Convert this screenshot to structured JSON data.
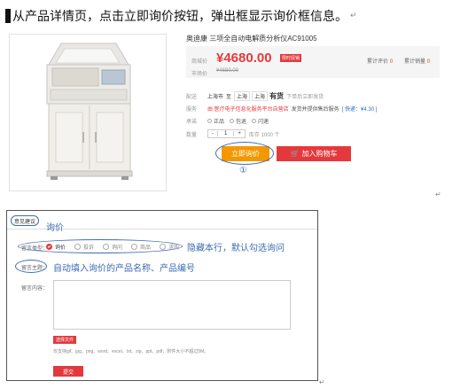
{
  "intro": {
    "text": "从产品详情页，点击立即询价按钮，弹出框显示询价框信息。",
    "para_mark": "↵"
  },
  "product": {
    "title": "奥迪康 三项全自动电解质分析仪AC91005",
    "price_label": "商城价",
    "price": "¥4680.00",
    "discount_tag": "限时促销",
    "market_label": "市场价",
    "market_price": "¥4680.00",
    "review_label": "累计评价",
    "review_count": "0",
    "sales_label": "累计销量",
    "sales_count": "0",
    "ship_label": "配送",
    "ship_from": "上海市",
    "ship_to_word": "至",
    "ship_province": "上海",
    "ship_city": "上海",
    "in_stock": "有货",
    "order_hint": "下单后立即发货",
    "service_label": "服务",
    "service_provider": "由 医疗电子信息化服务平台自营店",
    "service_text": "发货并提供售后服务",
    "service_fee": "[ 快递：¥4.30 ]",
    "pay_label": "承诺",
    "pay_options": [
      "正品",
      "包退",
      "闪速"
    ],
    "qty_label": "数量",
    "qty_minus": "-",
    "qty_value": "1",
    "qty_plus": "+",
    "stock_text": "库存 1000 个",
    "inquiry_button": "立即询价",
    "cart_icon": "cart-icon",
    "cart_button": "加入购物车",
    "annotation_number": "①",
    "para_mark": "↵"
  },
  "form": {
    "tab_label": "意见建议",
    "tab_note": "询价",
    "type_label": "留言类型：",
    "type_options": [
      "询价",
      "投诉",
      "询问",
      "商品",
      "求购"
    ],
    "type_selected": "询价",
    "type_note": "隐藏本行，默认勾选询问",
    "subject_label": "留言主题：",
    "subject_note": "自动填入询价的产品名称、产品编号",
    "content_label": "留言内容：",
    "file_button": "选择文件",
    "file_hint": "仅支持gif、jpg、png、word、excel、txt、zip、ppt、pdf，附件大小不超过5M。",
    "submit_button": "提交",
    "para_mark": "↵"
  },
  "colors": {
    "accent_red": "#e4393c",
    "orange": "#f39800",
    "annotation_blue": "#3d6bb3"
  }
}
